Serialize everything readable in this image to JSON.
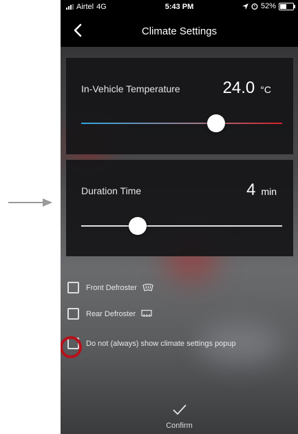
{
  "status_bar": {
    "carrier": "Airtel",
    "network": "4G",
    "time": "5:43 PM",
    "battery": "52%",
    "battery_level": 0.52
  },
  "header": {
    "title": "Climate Settings"
  },
  "temperature": {
    "label": "In-Vehicle Temperature",
    "value": "24.0",
    "unit": "°C",
    "slider_fraction": 0.67
  },
  "duration": {
    "label": "Duration Time",
    "value": "4",
    "unit": "min",
    "slider_fraction": 0.28
  },
  "options": [
    {
      "label": "Front Defroster",
      "checked": false,
      "icon": "front-defrost-icon"
    },
    {
      "label": "Rear Defroster",
      "checked": false,
      "icon": "rear-defrost-icon"
    },
    {
      "label": "Do not (always) show climate settings popup",
      "checked": false
    }
  ],
  "confirm": {
    "label": "Confirm",
    "icon": "checkmark-icon"
  },
  "colors": {
    "cold": "#2fa4e0",
    "hot": "#d61f26",
    "highlight": "#b5121b"
  }
}
